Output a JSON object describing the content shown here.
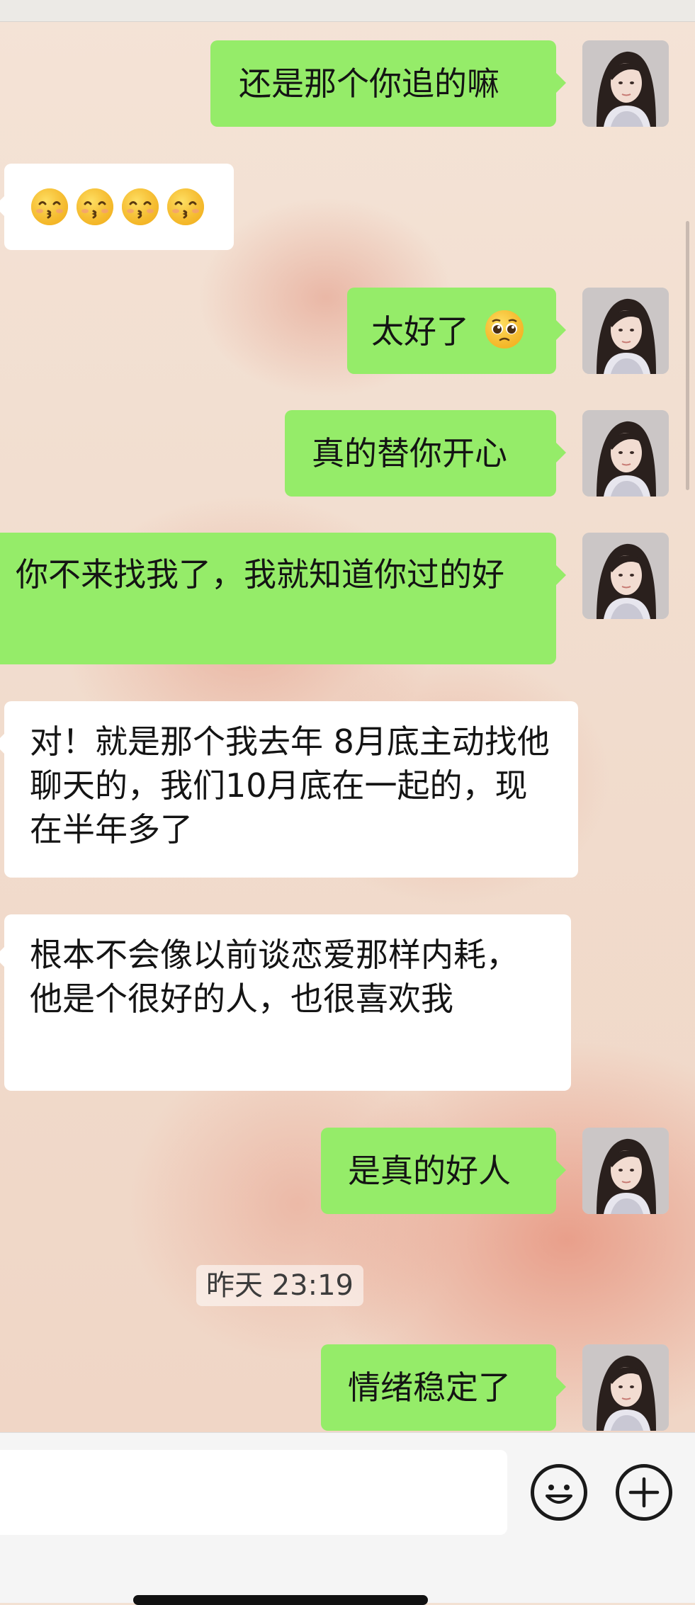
{
  "chat": {
    "messages": [
      {
        "side": "out",
        "text": "还是那个你追的嘛"
      },
      {
        "side": "in",
        "emoji": [
          "kissing-smiling-eyes",
          "kissing-smiling-eyes",
          "kissing-smiling-eyes",
          "kissing-smiling-eyes"
        ]
      },
      {
        "side": "out",
        "text": "太好了",
        "emoji": "pleading-face"
      },
      {
        "side": "out",
        "text": "真的替你开心"
      },
      {
        "side": "out",
        "text": "你不来找我了，我就知道你过的好"
      },
      {
        "side": "in",
        "text": "对！就是那个我去年 8月底主动找他聊天的，我们10月底在一起的，现在半年多了"
      },
      {
        "side": "in",
        "text": "根本不会像以前谈恋爱那样内耗，他是个很好的人，也很喜欢我"
      },
      {
        "side": "out",
        "text": "是真的好人"
      },
      {
        "side": "out",
        "text": "情绪稳定了"
      }
    ],
    "timestamp": "昨天 23:19"
  },
  "colors": {
    "outgoing_bubble": "#95ec69",
    "incoming_bubble": "#ffffff",
    "input_bar": "#f5f5f5"
  },
  "icons": {
    "emoji_button": "smiley-face-icon",
    "more_button": "plus-circle-icon"
  }
}
